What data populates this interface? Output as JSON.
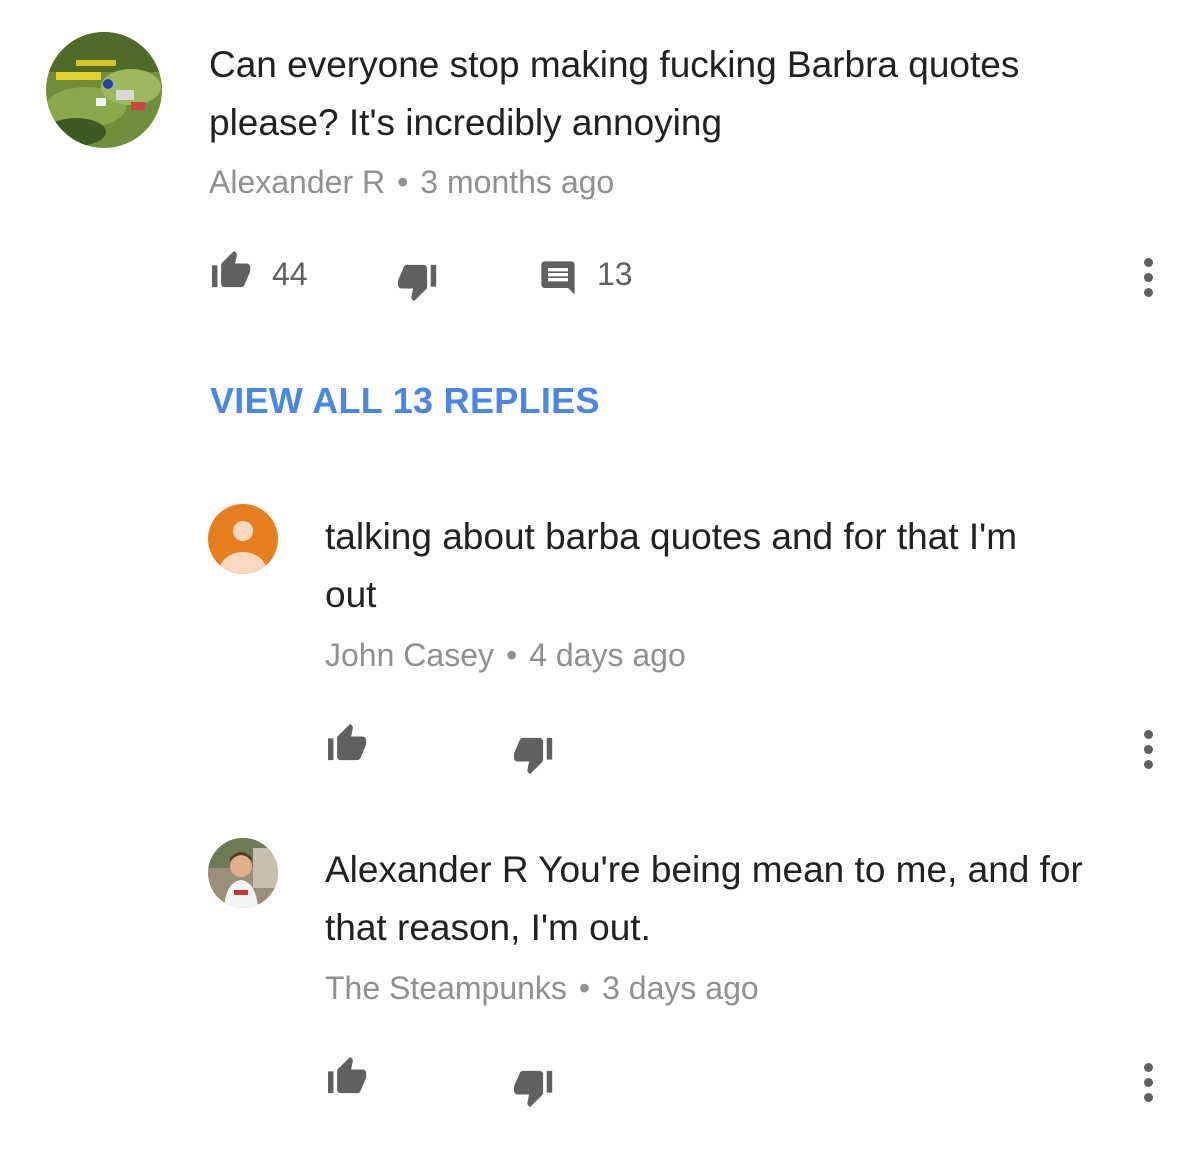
{
  "comment": {
    "text_line1": "Can everyone stop making fucking Barbra quotes",
    "text_line2": "please? It's incredibly annoying",
    "author": "Alexander R",
    "time": "3 months ago",
    "likes": "44",
    "replies_count": "13",
    "avatar_icon": "landscape-photo-avatar"
  },
  "view_all_label": "VIEW ALL 13 REPLIES",
  "replies": [
    {
      "text_line1": "talking about barba quotes and for that I'm",
      "text_line2": "out",
      "author": "John Casey",
      "time": "4 days ago",
      "avatar_icon": "default-person-avatar"
    },
    {
      "text_line1": "Alexander R You're being mean to me, and for",
      "text_line2": "that reason, I'm out.",
      "author": "The Steampunks",
      "time": "3 days ago",
      "avatar_icon": "child-photo-avatar"
    }
  ],
  "separator": "•",
  "colors": {
    "link": "#4a86e8",
    "meta": "#909090",
    "icon": "#606060",
    "default_avatar": "#e67e22"
  }
}
